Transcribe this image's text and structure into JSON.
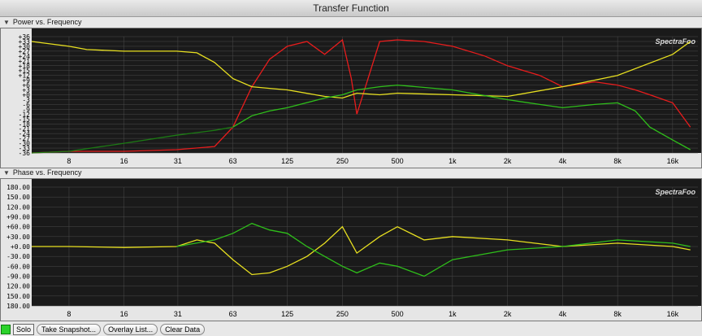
{
  "window": {
    "title": "Transfer Function"
  },
  "sections": {
    "power": {
      "label": "Power vs. Frequency"
    },
    "phase": {
      "label": "Phase vs. Frequency"
    }
  },
  "brand": "SpectraFoo",
  "power_chart": {
    "yticks": [
      "+36",
      "+33",
      "+30",
      "+27",
      "+24",
      "+21",
      "+18",
      "+15",
      "+12",
      "+9",
      "+6",
      "+3",
      "+0",
      "-3",
      "-6",
      "-9",
      "-12",
      "-15",
      "-18",
      "-21",
      "-24",
      "-27",
      "-30",
      "-33",
      "-36"
    ]
  },
  "phase_chart": {
    "yticks": [
      "180.00",
      "150.00",
      "120.00",
      "+90.00",
      "+60.00",
      "+30.00",
      "+0.00",
      "-30.00",
      "-60.00",
      "-90.00",
      "120.00",
      "150.00",
      "180.00"
    ]
  },
  "xticks": [
    "8",
    "16",
    "31",
    "63",
    "125",
    "250",
    "500",
    "1k",
    "2k",
    "4k",
    "8k",
    "16k"
  ],
  "toolbar": {
    "solo_label": "Solo",
    "snapshot_label": "Take Snapshot...",
    "overlay_label": "Overlay List...",
    "clear_label": "Clear Data"
  },
  "colors": {
    "red": "#e81c1c",
    "yellow": "#e8e020",
    "green": "#2fbf1a",
    "dark_green": "#1c7a14",
    "plot_bg": "#1a1a1a",
    "grid": "#4a4a4a"
  },
  "chart_data": [
    {
      "type": "line",
      "title": "Power vs. Frequency",
      "x_scale": "log",
      "x_ticks": [
        "8",
        "16",
        "31",
        "63",
        "125",
        "250",
        "500",
        "1k",
        "2k",
        "4k",
        "8k",
        "16k"
      ],
      "ylim": [
        -36,
        36
      ],
      "grid": true,
      "series": [
        {
          "color": "#e81c1c",
          "x": [
            5,
            8,
            16,
            31,
            50,
            63,
            80,
            100,
            125,
            160,
            200,
            250,
            280,
            300,
            400,
            500,
            700,
            1000,
            1500,
            2000,
            3000,
            4000,
            6000,
            8000,
            10000,
            12000,
            16000,
            20000
          ],
          "y": [
            -36,
            -35,
            -35,
            -34,
            -32,
            -20,
            5,
            22,
            30,
            33,
            25,
            34,
            10,
            -12,
            33,
            34,
            33,
            30,
            24,
            18,
            12,
            5,
            8,
            6,
            3,
            0,
            -5,
            -20
          ]
        },
        {
          "color": "#e8e020",
          "x": [
            5,
            8,
            10,
            16,
            31,
            40,
            50,
            63,
            80,
            100,
            125,
            200,
            250,
            300,
            400,
            500,
            1000,
            2000,
            4000,
            8000,
            16000,
            20000
          ],
          "y": [
            33,
            30,
            28,
            27,
            27,
            26,
            20,
            10,
            5,
            4,
            3,
            -1,
            -2,
            1,
            0,
            1,
            0,
            -1,
            5,
            12,
            25,
            33
          ]
        },
        {
          "color": "#2fbf1a",
          "x": [
            63,
            80,
            100,
            125,
            200,
            250,
            300,
            400,
            500,
            1000,
            2000,
            3000,
            4000,
            6000,
            8000,
            10000,
            12000,
            16000,
            20000
          ],
          "y": [
            -20,
            -13,
            -10,
            -8,
            -2,
            0,
            3,
            5,
            6,
            3,
            -3,
            -6,
            -8,
            -6,
            -5,
            -10,
            -20,
            -28,
            -34
          ]
        },
        {
          "color": "#1c7a14",
          "x": [
            5,
            8,
            16,
            31,
            50,
            63
          ],
          "y": [
            -36,
            -35,
            -30,
            -25,
            -22,
            -20
          ]
        }
      ]
    },
    {
      "type": "line",
      "title": "Phase vs. Frequency",
      "x_scale": "log",
      "x_ticks": [
        "8",
        "16",
        "31",
        "63",
        "125",
        "250",
        "500",
        "1k",
        "2k",
        "4k",
        "8k",
        "16k"
      ],
      "ylim": [
        -180,
        180
      ],
      "grid": true,
      "series": [
        {
          "color": "#e8e020",
          "x": [
            5,
            8,
            16,
            31,
            40,
            50,
            63,
            80,
            100,
            125,
            160,
            200,
            250,
            300,
            400,
            500,
            700,
            1000,
            2000,
            4000,
            8000,
            16000,
            20000
          ],
          "y": [
            0,
            0,
            -3,
            0,
            20,
            10,
            -40,
            -85,
            -80,
            -60,
            -30,
            10,
            60,
            -20,
            30,
            60,
            20,
            30,
            20,
            0,
            10,
            0,
            -10
          ]
        },
        {
          "color": "#2fbf1a",
          "x": [
            31,
            50,
            63,
            80,
            100,
            125,
            160,
            200,
            250,
            300,
            400,
            500,
            700,
            1000,
            2000,
            4000,
            8000,
            16000,
            20000
          ],
          "y": [
            0,
            20,
            40,
            70,
            50,
            40,
            0,
            -30,
            -60,
            -80,
            -50,
            -60,
            -90,
            -40,
            -10,
            0,
            20,
            10,
            0
          ]
        }
      ]
    }
  ]
}
